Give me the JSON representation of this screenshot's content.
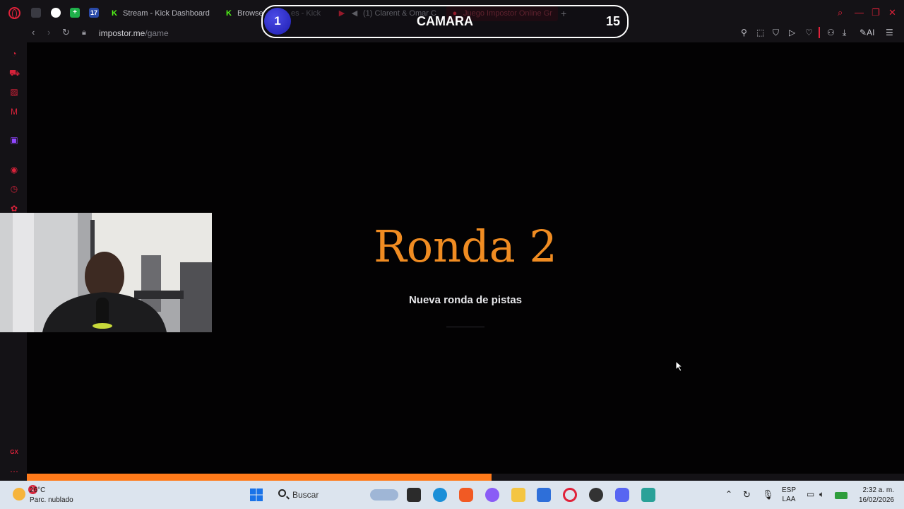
{
  "browser": {
    "tabs": [
      {
        "label": "Stream - Kick Dashboard"
      },
      {
        "label": "Browse"
      },
      {
        "label": "es - Kick"
      },
      {
        "label": "(1) Clarent & Omar Co"
      },
      {
        "label": "Juego Impostor Online Gr"
      }
    ],
    "pinned_tab_label": "17",
    "url_host": "impostor.me",
    "url_path": "/game",
    "ai_label": "AI"
  },
  "overlay": {
    "badge": "1",
    "label": "CAMARA",
    "count": "15"
  },
  "game": {
    "title": "Ronda 2",
    "subtitle": "Nueva ronda de pistas",
    "progress": 0.53
  },
  "sidebar": {
    "bottom_label": "GX"
  },
  "taskbar": {
    "weather_temp": "26°C",
    "weather_desc": "Parc. nublado",
    "weather_badge": "1",
    "search_label": "Buscar",
    "lang_top": "ESP",
    "lang_bottom": "LAA",
    "time": "2:32 a. m.",
    "date": "16/02/2026"
  },
  "colors": {
    "accent": "#e0223a",
    "title_orange": "#f08c22",
    "progress_orange": "#ff7a1a",
    "overlay_badge": "#2a2ac8"
  }
}
